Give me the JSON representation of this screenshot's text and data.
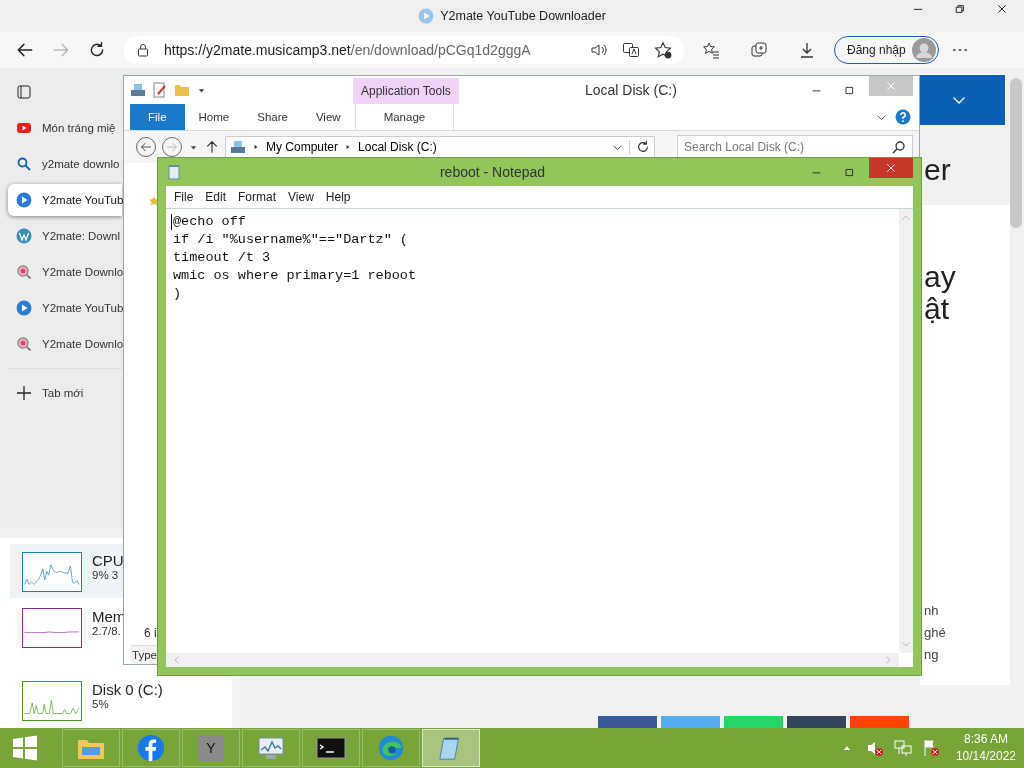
{
  "browser": {
    "title": "Y2mate YouTube Downloader",
    "url_host": "https://y2mate.musicamp3.net",
    "url_path": "/en/download/pCGq1d2gggA",
    "sign_in": "Đăng nhập",
    "tabs": [
      {
        "kind": "youtube",
        "title": "Món tráng miệ",
        "selected": false
      },
      {
        "kind": "search",
        "title": "y2mate downlo",
        "selected": false
      },
      {
        "kind": "play",
        "title": "Y2mate YouTub",
        "selected": true
      },
      {
        "kind": "wordpress",
        "title": "Y2mate: Downl",
        "selected": false
      },
      {
        "kind": "magnifier",
        "title": "Y2mate Downlo",
        "selected": false
      },
      {
        "kind": "play",
        "title": "Y2mate YouTub",
        "selected": false
      },
      {
        "kind": "magnifier",
        "title": "Y2mate Downlo",
        "selected": false
      }
    ],
    "new_tab": "Tab mới",
    "page_fragments": [
      {
        "kind": "heading",
        "text": "er"
      },
      {
        "kind": "heading",
        "text": "ay"
      },
      {
        "kind": "heading",
        "text": "ật"
      },
      {
        "kind": "body",
        "text": "nh"
      },
      {
        "kind": "body",
        "text": "ghé"
      },
      {
        "kind": "body",
        "text": "ng"
      }
    ]
  },
  "task_manager": {
    "items": [
      {
        "name": "CPU",
        "value": "9% 3",
        "color": "#1f7fb8",
        "selected": true
      },
      {
        "name": "Mem",
        "value": "2.7/8.",
        "color": "#8b2a9b",
        "selected": false
      },
      {
        "name": "Disk 0 (C:)",
        "value": "5%",
        "color": "#4d9a1f",
        "selected": false
      }
    ]
  },
  "explorer": {
    "title": "Local Disk (C:)",
    "context_tab": "Application Tools",
    "ribbon_tabs": [
      {
        "kind": "file",
        "label": "File"
      },
      {
        "kind": "tab",
        "label": "Home"
      },
      {
        "kind": "tab",
        "label": "Share"
      },
      {
        "kind": "tab",
        "label": "View"
      },
      {
        "kind": "context",
        "label": "Manage"
      }
    ],
    "breadcrumb": [
      "My Computer",
      "Local Disk (C:)"
    ],
    "search_placeholder": "Search Local Disk (C:)",
    "status": "6 i",
    "column": "Type"
  },
  "notepad": {
    "title": "reboot - Notepad",
    "menu": [
      "File",
      "Edit",
      "Format",
      "View",
      "Help"
    ],
    "lines": [
      "@echo off",
      "if /i \"%username%\"==\"Dartz\" (",
      "timeout /t 3",
      "wmic os where primary=1 reboot",
      ")"
    ]
  },
  "taskbar": {
    "apps": [
      {
        "kind": "explorer",
        "active": false
      },
      {
        "kind": "facebook",
        "active": false
      },
      {
        "kind": "letter",
        "label": "Y",
        "active": false
      },
      {
        "kind": "taskmgr",
        "active": false
      },
      {
        "kind": "cmd",
        "active": false
      },
      {
        "kind": "edge",
        "active": false
      },
      {
        "kind": "notepad",
        "active": true
      }
    ],
    "time": "8:36 AM",
    "date": "10/14/2022"
  }
}
